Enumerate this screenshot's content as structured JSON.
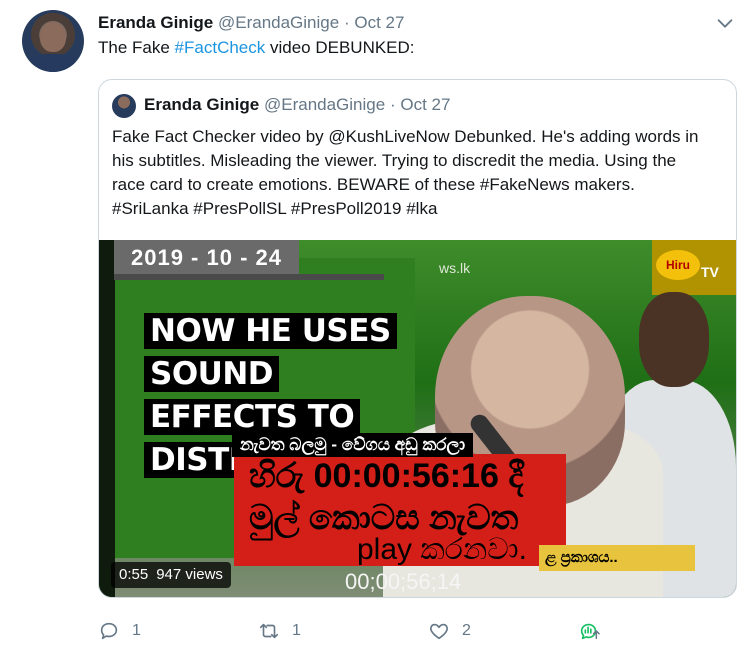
{
  "tweet": {
    "author_name": "Eranda Ginige",
    "author_handle": "@ErandaGinige",
    "dot": "·",
    "date": "Oct 27",
    "text_prefix": "The Fake ",
    "text_hashtag": "#FactCheck",
    "text_suffix": " video DEBUNKED:"
  },
  "quoted": {
    "author_name": "Eranda Ginige",
    "author_handle": "@ErandaGinige",
    "dot": "·",
    "date": "Oct 27",
    "text": "Fake Fact Checker video by @KushLiveNow Debunked. He's adding words in his subtitles. Misleading the viewer. Trying to discredit the media. Using the race card to create emotions. BEWARE of these #FakeNews makers. #SriLanka #PresPollSL #PresPoll2019 #lka",
    "video": {
      "date_overlay": "2019 - 10 - 24",
      "caption": "NOW HE USES SOUND EFFECTS TO DISTRACT YOU",
      "sign_text": "ws.lk",
      "logo_text": "Hiru",
      "tv_text": "TV",
      "sub_line1": "නැවත බලමු - වේගය අඩු කරලා",
      "red_line1": "හිරු 00:00:56:16 දී",
      "red_line2": "මුල් කොටස නැවත",
      "red_line3": "play කරනවා.",
      "sub_line2": "ළ ප්‍රකාශය..",
      "bottom_timecode": "00;00;56;14",
      "duration": "0:55",
      "views": "947 views"
    }
  },
  "actions": {
    "reply_count": "1",
    "retweet_count": "1",
    "like_count": "2"
  },
  "colors": {
    "link": "#1b95e0",
    "muted": "#657786",
    "border": "#ccd6dd"
  }
}
